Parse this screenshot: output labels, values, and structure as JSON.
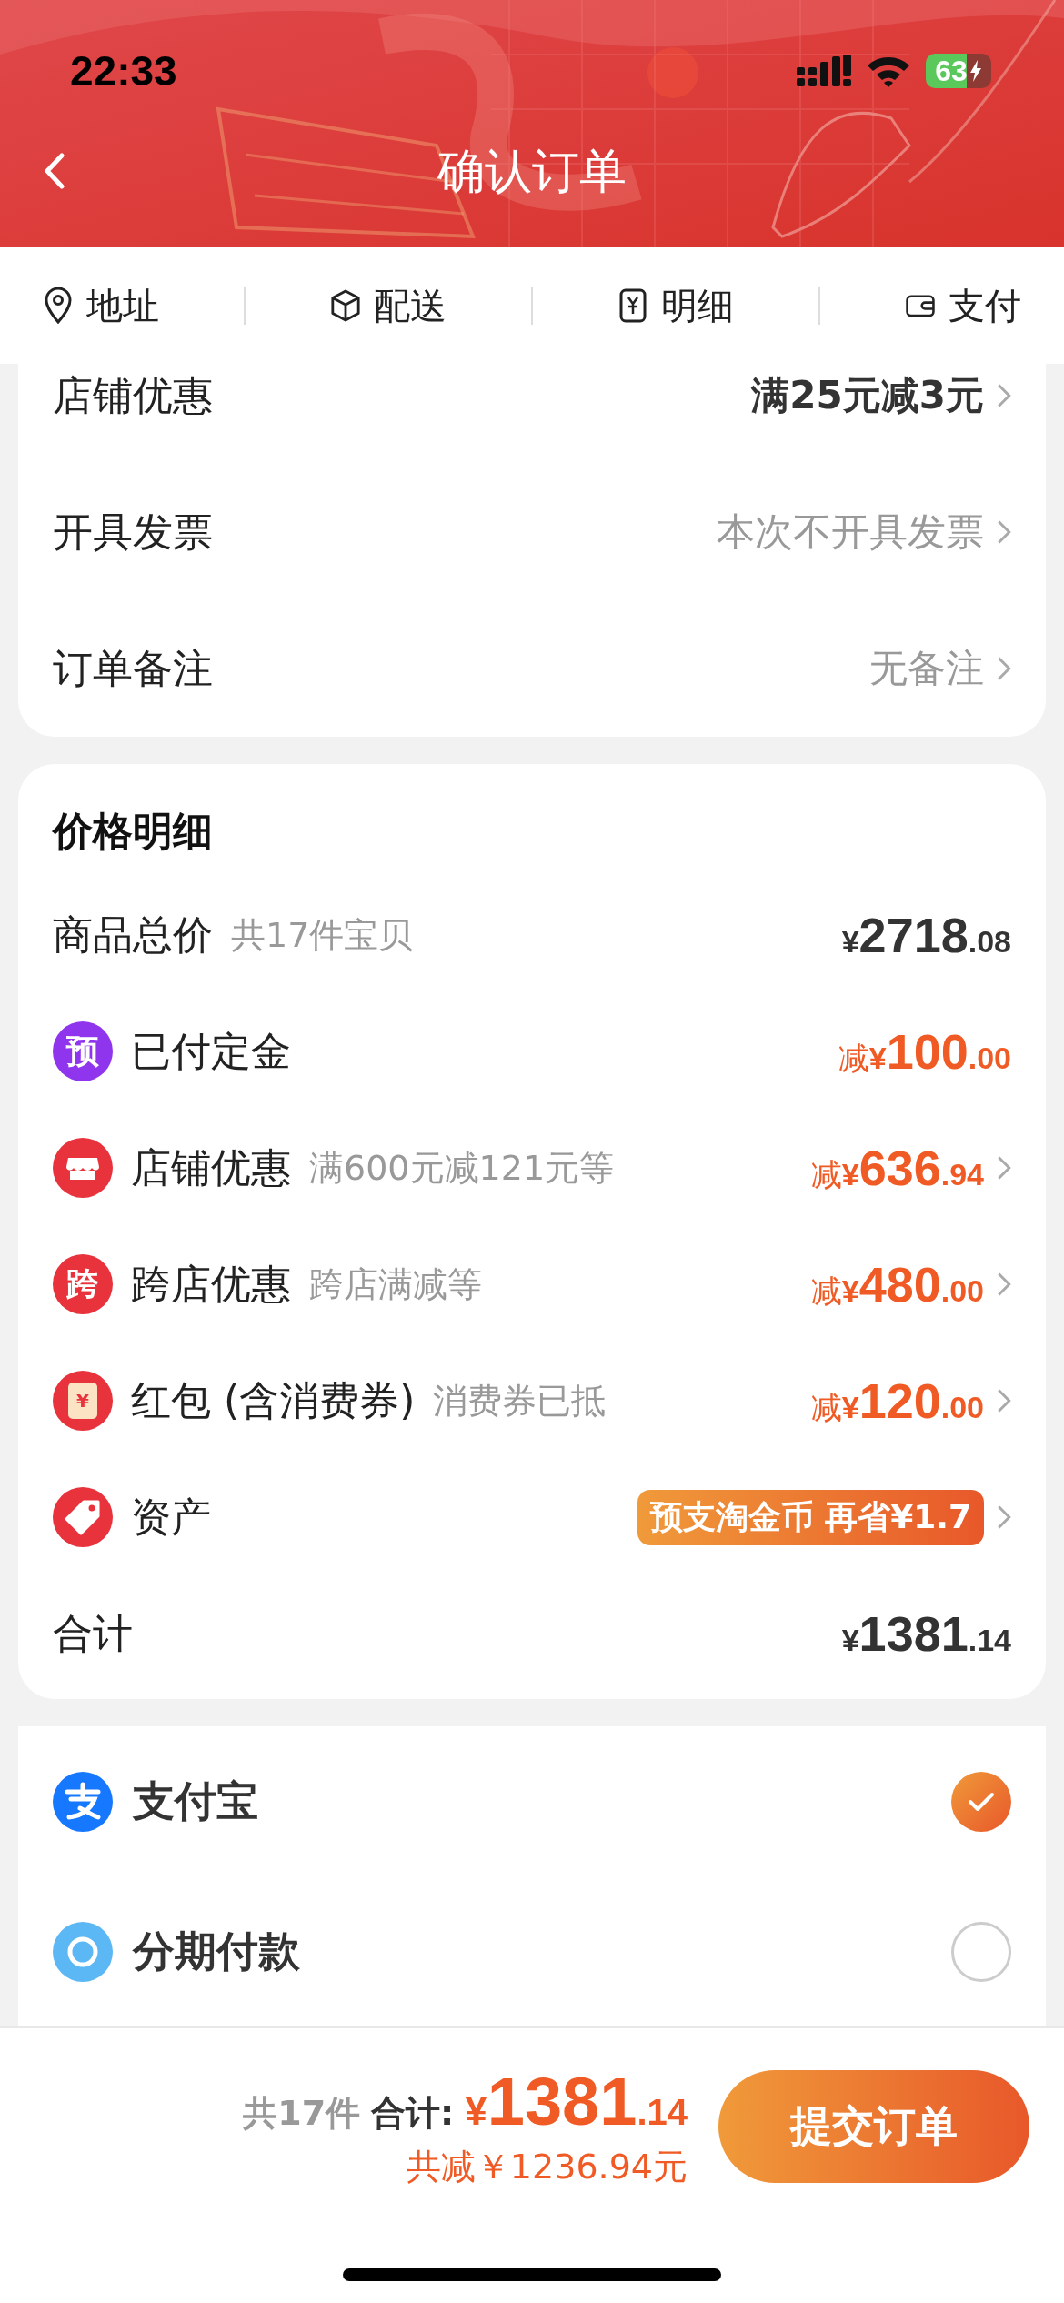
{
  "status_bar": {
    "time": "22:33",
    "battery": "63"
  },
  "header": {
    "title": "确认订单"
  },
  "anchor_tabs": [
    {
      "label": "地址",
      "kind": "pin"
    },
    {
      "label": "配送",
      "kind": "box"
    },
    {
      "label": "明细",
      "kind": "bill"
    },
    {
      "label": "支付",
      "kind": "wallet"
    }
  ],
  "order_options": [
    {
      "label": "店铺优惠",
      "value": "满25元减3元",
      "kind": "offer"
    },
    {
      "label": "开具发票",
      "value": "本次不开具发票",
      "kind": "plain"
    },
    {
      "label": "订单备注",
      "value": "无备注",
      "kind": "plain"
    }
  ],
  "price_details": {
    "title": "价格明细",
    "rows": [
      {
        "kind": "total",
        "label": "商品总价",
        "note": "共17件宝贝",
        "currency": "¥",
        "integer": "2718",
        "decimal": ".08",
        "chevron": false
      },
      {
        "kind": "discount",
        "icon": {
          "kind": "badge",
          "text": "预",
          "color": "#9035ee"
        },
        "label": "已付定金",
        "prefix": "减",
        "currency": "¥",
        "integer": "100",
        "decimal": ".00",
        "chevron": false
      },
      {
        "kind": "discount",
        "icon": {
          "kind": "shop",
          "color": "#e8323c"
        },
        "label": "店铺优惠",
        "note": "满600元减121元等",
        "prefix": "减",
        "currency": "¥",
        "integer": "636",
        "decimal": ".94",
        "chevron": true
      },
      {
        "kind": "discount",
        "icon": {
          "kind": "badge",
          "text": "跨",
          "color": "#e8323c"
        },
        "label": "跨店优惠",
        "note": "跨店满减等",
        "prefix": "减",
        "currency": "¥",
        "integer": "480",
        "decimal": ".00",
        "chevron": true
      },
      {
        "kind": "discount",
        "icon": {
          "kind": "envelope",
          "text": "¥",
          "color": "#e8323c"
        },
        "label": "红包 (含消费券)",
        "note": "消费券已抵",
        "prefix": "减",
        "currency": "¥",
        "integer": "120",
        "decimal": ".00",
        "chevron": true
      },
      {
        "kind": "promo",
        "icon": {
          "kind": "tag",
          "color": "#e8323c"
        },
        "label": "资产",
        "promo": "预支淘金币 再省¥1.7",
        "chevron": true
      },
      {
        "kind": "total",
        "label": "合计",
        "currency": "¥",
        "integer": "1381",
        "decimal": ".14",
        "chevron": false
      }
    ]
  },
  "payment_methods": [
    {
      "name": "支付宝",
      "kind": "alipay",
      "selected": true
    },
    {
      "name": "分期付款",
      "kind": "installment",
      "selected": false
    }
  ],
  "footer": {
    "count": "共17件",
    "total_label": "合计:",
    "currency": "¥",
    "integer": "1381",
    "decimal": ".14",
    "saved": "共减￥1236.94元",
    "submit": "提交订单"
  }
}
